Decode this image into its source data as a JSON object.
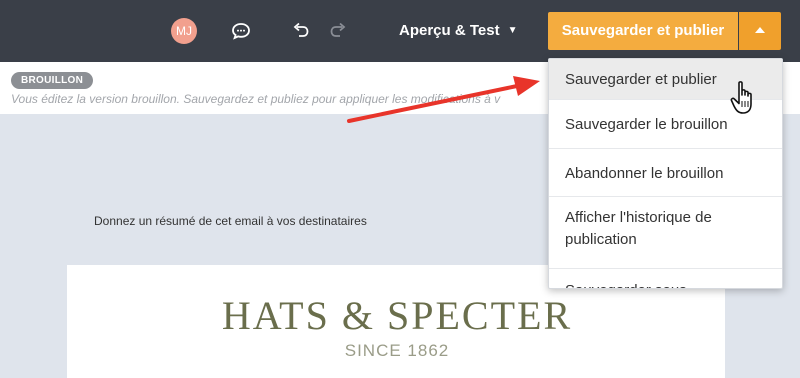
{
  "header": {
    "avatar_initials": "MJ",
    "preview_label": "Aperçu & Test",
    "save_publish_label": "Sauvegarder et publier",
    "icons": [
      "comment-icon",
      "undo-icon",
      "redo-icon",
      "chevron-down-icon",
      "caret-up-icon"
    ]
  },
  "draft": {
    "badge": "BROUILLON",
    "note": "Vous éditez la version brouillon. Sauvegardez et publiez pour appliquer les modifications à v"
  },
  "email": {
    "summary_label": "Donnez un résumé de cet email à vos destinataires",
    "brand": "HATS & SPECTER",
    "since": "SINCE 1862"
  },
  "dropdown": {
    "items": [
      "Sauvegarder et publier",
      "Sauvegarder le brouillon",
      "Abandonner le brouillon",
      "Afficher l'historique de publication",
      "Sauvegarder sous"
    ]
  },
  "colors": {
    "topbar": "#3a3f48",
    "accent": "#f4ac3f",
    "annotation_arrow": "#e8342a",
    "canvas": "#dfe4ec"
  }
}
